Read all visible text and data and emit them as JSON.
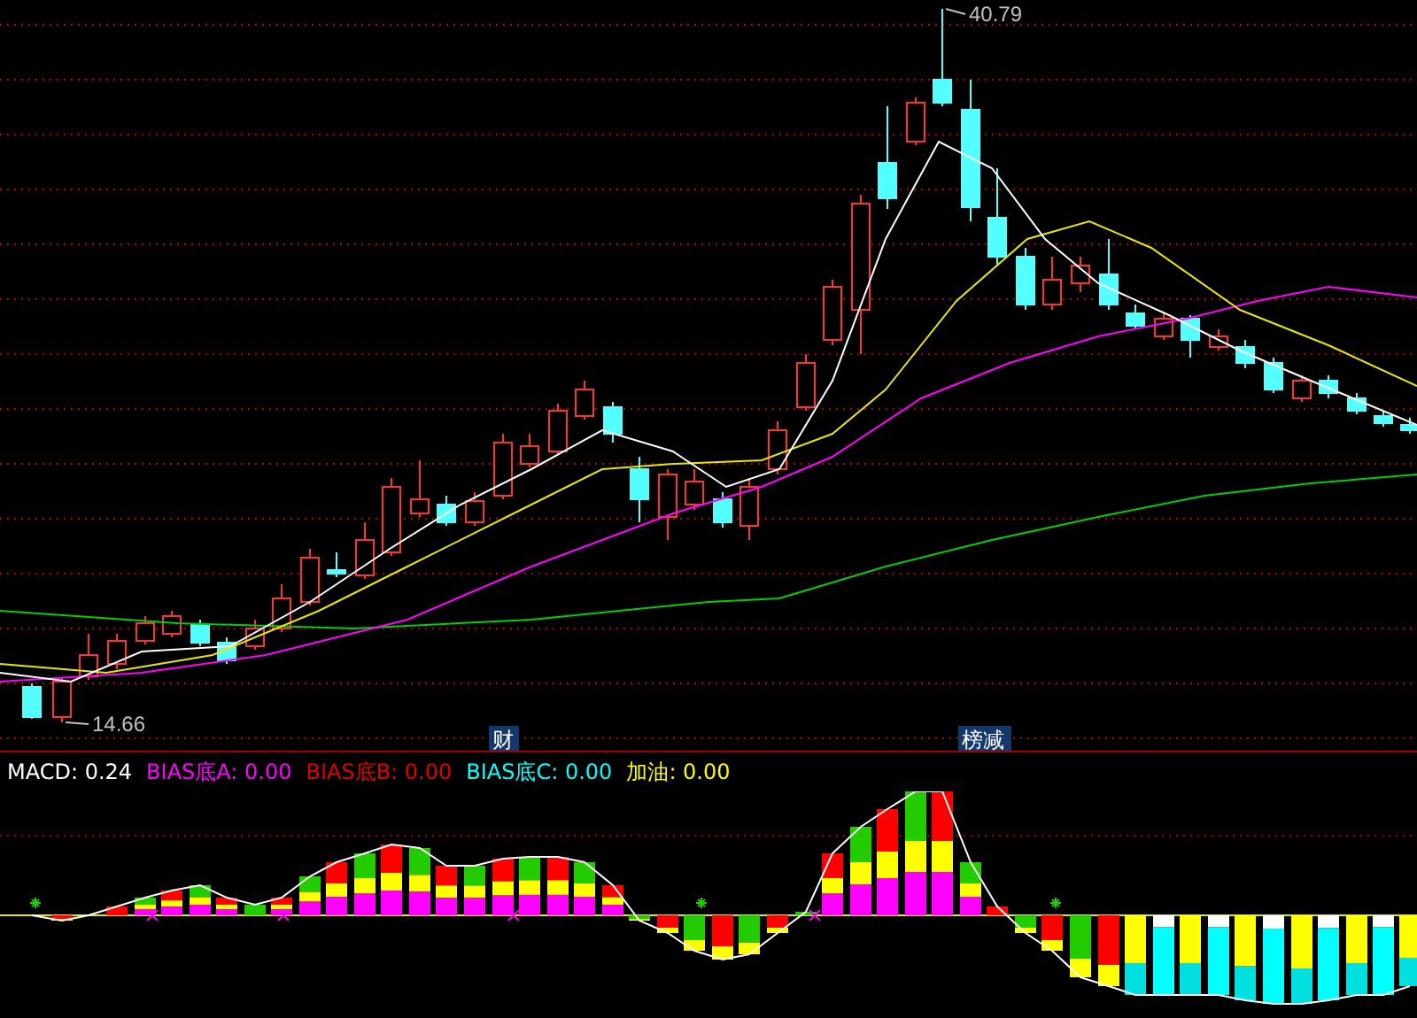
{
  "price_chart": {
    "high_label": "40.79",
    "low_label": "14.66",
    "event_tags": [
      {
        "label": "财"
      },
      {
        "label": "榜减"
      }
    ]
  },
  "indicator_panel": {
    "legend": [
      {
        "label": "MACD: 0.24",
        "color": "#ffffff"
      },
      {
        "label": "BIAS底A: 0.00",
        "color": "#ff00ff"
      },
      {
        "label": "BIAS底B: 0.00",
        "color": "#e00000"
      },
      {
        "label": "BIAS底C: 0.00",
        "color": "#00ffff"
      },
      {
        "label": "加油: 0.00",
        "color": "#ffff00"
      }
    ]
  }
}
